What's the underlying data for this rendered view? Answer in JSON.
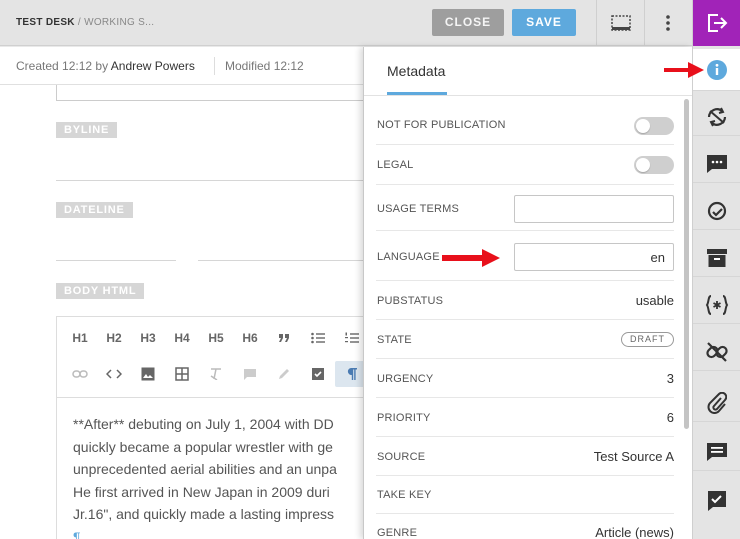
{
  "topbar": {
    "desk": "TEST DESK",
    "separator": " / ",
    "stage": "WORKING S...",
    "close_label": "CLOSE",
    "save_label": "SAVE"
  },
  "editor": {
    "created_prefix": "Created",
    "created_time": "12:12",
    "by_word": "by",
    "author": "Andrew Powers",
    "modified_label": "Modified 12:12",
    "fields": {
      "byline": "BYLINE",
      "dateline": "DATELINE",
      "body_html": "BODY HTML"
    },
    "format_row1": [
      "H1",
      "H2",
      "H3",
      "H4",
      "H5",
      "H6"
    ],
    "body_lines": [
      "**After** debuting on July 1, 2004 with DD",
      "quickly became a popular wrestler with ge",
      "unprecedented aerial abilities and an unpa",
      "He first arrived in New Japan in 2009 duri",
      "Jr.16\", and quickly made a lasting impress"
    ],
    "pilcrow": "¶"
  },
  "panel": {
    "tab": "Metadata",
    "rows": {
      "not_for_publication": "NOT FOR PUBLICATION",
      "legal": "LEGAL",
      "usage_terms": "USAGE TERMS",
      "language": "LANGUAGE",
      "pubstatus": "PUBSTATUS",
      "state": "STATE",
      "urgency": "URGENCY",
      "priority": "PRIORITY",
      "source": "SOURCE",
      "take_key": "TAKE KEY",
      "genre": "GENRE"
    },
    "values": {
      "language": "en",
      "usage_terms": "",
      "pubstatus": "usable",
      "state": "DRAFT",
      "urgency": "3",
      "priority": "6",
      "source": "Test Source A",
      "genre": "Article (news)"
    },
    "toggles": {
      "not_for_publication": false,
      "legal": false
    }
  },
  "colors": {
    "accent": "#5ea9dd",
    "exit": "#a123b8",
    "arrow": "#e8101b"
  }
}
